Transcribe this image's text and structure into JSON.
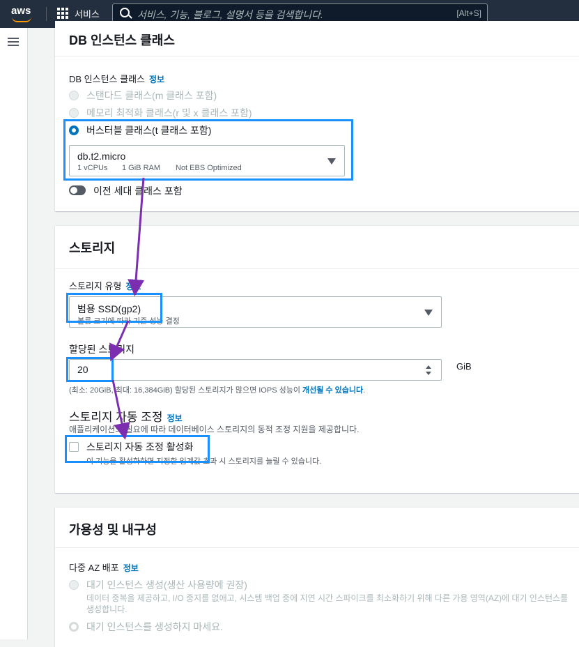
{
  "topbar": {
    "logo": "aws",
    "services": "서비스",
    "search_placeholder": "서비스, 기능, 블로그, 설명서 등을 검색합니다.",
    "search_shortcut": "[Alt+S]"
  },
  "instance_class": {
    "title": "DB 인스턴스 클래스",
    "field_label": "DB 인스턴스 클래스",
    "info": "정보",
    "options": [
      {
        "label": "스탠다드 클래스(m 클래스 포함)",
        "selected": false,
        "disabled": true
      },
      {
        "label": "메모리 최적화 클래스(r 및 x 클래스 포함)",
        "selected": false,
        "disabled": true
      },
      {
        "label": "버스터블 클래스(t 클래스 포함)",
        "selected": true,
        "disabled": false
      }
    ],
    "selected_class": "db.t2.micro",
    "specs": [
      "1 vCPUs",
      "1 GiB RAM",
      "Not EBS Optimized"
    ],
    "toggle_label": "이전 세대 클래스 포함"
  },
  "storage": {
    "title": "스토리지",
    "type_label": "스토리지 유형",
    "info": "정보",
    "type_value": "범용 SSD(gp2)",
    "type_desc": "볼륨 크기에 따라 기준 성능 결정",
    "allocated_label": "할당된 스토리지",
    "allocated_value": "20",
    "unit": "GiB",
    "allocated_hint": "(최소: 20GiB, 최대: 16,384GiB) 할당된 스토리지가 많으면 IOPS 성능이",
    "allocated_hint_link": "개선될 수 있습니다",
    "allocated_hint_end": ".",
    "autoscaling_title": "스토리지 자동 조정",
    "autoscaling_info": "정보",
    "autoscaling_desc": "애플리케이션의 필요에 따라 데이터베이스 스토리지의 동적 조정 지원을 제공합니다.",
    "autoscaling_check_label": "스토리지 자동 조정 활성화",
    "autoscaling_check_desc": "이 기능을 활성화하면 지정한 임계값 초과 시 스토리지를 늘릴 수 있습니다."
  },
  "availability": {
    "title": "가용성 및 내구성",
    "field_label": "다중 AZ 배포",
    "info": "정보",
    "options": [
      {
        "label": "대기 인스턴스 생성(생산 사용량에 권장)",
        "desc": "데이터 중복을 제공하고, I/O 중지를 없애고, 시스템 백업 중에 지연 시간 스파이크를 최소화하기 위해 다른 가용 영역(AZ)에 대기 인스턴스를 생성합니다."
      },
      {
        "label": "대기 인스턴스를 생성하지 마세요."
      }
    ]
  },
  "colors": {
    "accent": "#0073bb",
    "highlight": "#1a90ff",
    "arrow": "#7b2fb0",
    "topbar": "#232f3e"
  }
}
